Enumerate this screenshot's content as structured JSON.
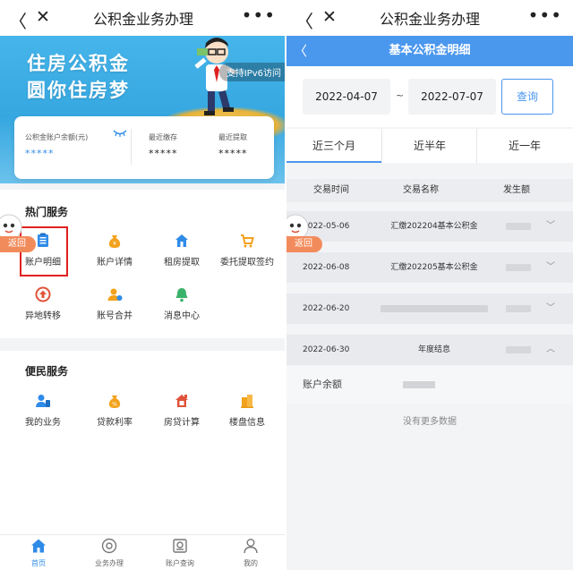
{
  "left": {
    "nav": {
      "title": "公积金业务办理",
      "back": "〈",
      "close": "✕",
      "more": "•••"
    },
    "banner": {
      "line1": "住房公积金",
      "line2": "圆你住房梦",
      "badge": "支持IPv6访问"
    },
    "account_card": {
      "balance_label": "公积金账户余额(元)",
      "balance_value": "*****",
      "deposit_label": "最近缴存",
      "deposit_value": "*****",
      "withdraw_label": "最近提取",
      "withdraw_value": "*****"
    },
    "hot_services": {
      "title": "热门服务",
      "items": [
        {
          "label": "账户明细",
          "icon": "document-list-icon",
          "color": "#2f8be8"
        },
        {
          "label": "账户详情",
          "icon": "money-bag-icon",
          "color": "#f3a21c"
        },
        {
          "label": "租房提取",
          "icon": "house-icon",
          "color": "#2f8be8"
        },
        {
          "label": "委托提取签约",
          "icon": "cart-icon",
          "color": "#f3a21c"
        },
        {
          "label": "异地转移",
          "icon": "transfer-icon",
          "color": "#e0533a"
        },
        {
          "label": "账号合并",
          "icon": "user-merge-icon",
          "color": "#f3a21c"
        },
        {
          "label": "消息中心",
          "icon": "bell-icon",
          "color": "#3bb26a"
        }
      ]
    },
    "convenience": {
      "title": "便民服务",
      "items": [
        {
          "label": "我的业务",
          "icon": "user-business-icon",
          "color": "#2f8be8"
        },
        {
          "label": "贷款利率",
          "icon": "percent-bag-icon",
          "color": "#f3a21c"
        },
        {
          "label": "房贷计算",
          "icon": "house-calc-icon",
          "color": "#e0533a"
        },
        {
          "label": "楼盘信息",
          "icon": "building-icon",
          "color": "#f3a21c"
        }
      ]
    },
    "float_back": "返回",
    "tabbar": [
      {
        "label": "首页",
        "icon": "home-icon",
        "active": true
      },
      {
        "label": "业务办理",
        "icon": "service-icon",
        "active": false
      },
      {
        "label": "账户查询",
        "icon": "account-query-icon",
        "active": false
      },
      {
        "label": "我的",
        "icon": "profile-icon",
        "active": false
      }
    ]
  },
  "right": {
    "nav": {
      "title": "公积金业务办理",
      "back": "〈",
      "close": "✕",
      "more": "•••"
    },
    "header": {
      "title": "基本公积金明细",
      "back": "〈"
    },
    "date_from": "2022-04-07",
    "date_sep": "~",
    "date_to": "2022-07-07",
    "query_label": "查询",
    "range_tabs": [
      {
        "label": "近三个月",
        "active": true
      },
      {
        "label": "近半年",
        "active": false
      },
      {
        "label": "近一年",
        "active": false
      }
    ],
    "table_headers": [
      "交易时间",
      "交易名称",
      "发生额"
    ],
    "rows": [
      {
        "date": "2022-05-06",
        "name": "汇缴202204基本公积金",
        "expanded": false
      },
      {
        "date": "2022-06-08",
        "name": "汇缴202205基本公积金",
        "expanded": false
      },
      {
        "date": "2022-06-20",
        "name": "",
        "expanded": false
      },
      {
        "date": "2022-06-30",
        "name": "年度结息",
        "expanded": true
      }
    ],
    "detail_label": "账户余额",
    "no_more": "没有更多数据",
    "float_back": "返回",
    "colors": {
      "accent": "#4a97ee",
      "highlight": "#e02020",
      "float": "#f28b5b"
    }
  }
}
